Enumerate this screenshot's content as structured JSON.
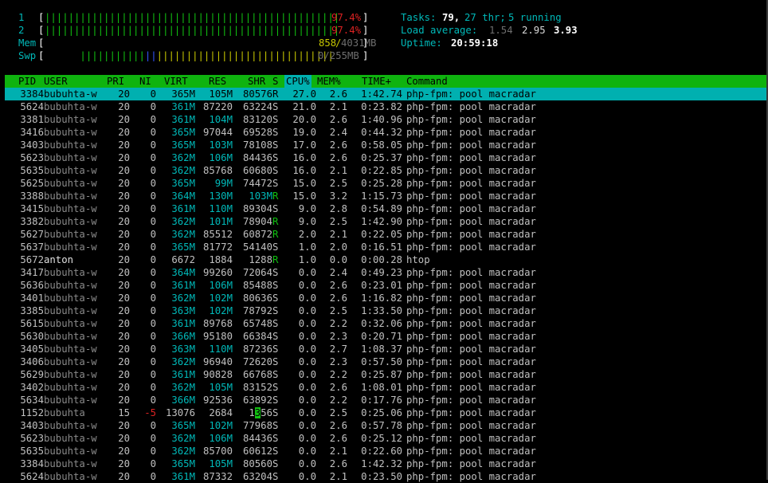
{
  "meters": {
    "cpu1": {
      "label": "1",
      "percent": "97.4%"
    },
    "cpu2": {
      "label": "2",
      "percent": "97.4%"
    },
    "mem": {
      "label": "Mem",
      "used": "858",
      "total": "4031MB"
    },
    "swp": {
      "label": "Swp",
      "value": "0/255MB"
    }
  },
  "meter_fill": {
    "cpu1": 0.974,
    "cpu2": 0.974,
    "mem": 0.213,
    "swp": 0.0
  },
  "stats": {
    "tasks_label": "Tasks:",
    "tasks": "79,",
    "threads": "27 thr;",
    "running": "5 running",
    "load_label": "Load average:",
    "load1": "1.54",
    "load5": "2.95",
    "load15": "3.93",
    "uptime_label": "Uptime:",
    "uptime": "20:59:18"
  },
  "columns": [
    "PID",
    "USER",
    "PRI",
    "NI",
    "VIRT",
    "RES",
    "SHR",
    "S",
    "CPU%",
    "MEM%",
    "TIME+",
    "Command"
  ],
  "sorted_column": "CPU%",
  "processes": [
    {
      "pid": "3384",
      "user": "bubuhta-w",
      "pri": "20",
      "ni": "0",
      "virt": "365M",
      "res": "105M",
      "shr": "80576",
      "s": "R",
      "cpu": "27.0",
      "mem": "2.6",
      "time": "1:42.74",
      "cmd": "php-fpm: pool macradar",
      "selected": true
    },
    {
      "pid": "5624",
      "user": "bubuhta-w",
      "pri": "20",
      "ni": "0",
      "virt": "361M",
      "res": "87220",
      "shr": "63224",
      "s": "S",
      "cpu": "21.0",
      "mem": "2.1",
      "time": "0:23.82",
      "cmd": "php-fpm: pool macradar"
    },
    {
      "pid": "3381",
      "user": "bubuhta-w",
      "pri": "20",
      "ni": "0",
      "virt": "361M",
      "res": "104M",
      "shr": "83120",
      "s": "S",
      "cpu": "20.0",
      "mem": "2.6",
      "time": "1:40.96",
      "cmd": "php-fpm: pool macradar"
    },
    {
      "pid": "3416",
      "user": "bubuhta-w",
      "pri": "20",
      "ni": "0",
      "virt": "365M",
      "res": "97044",
      "shr": "69528",
      "s": "S",
      "cpu": "19.0",
      "mem": "2.4",
      "time": "0:44.32",
      "cmd": "php-fpm: pool macradar"
    },
    {
      "pid": "3403",
      "user": "bubuhta-w",
      "pri": "20",
      "ni": "0",
      "virt": "365M",
      "res": "103M",
      "shr": "78108",
      "s": "S",
      "cpu": "17.0",
      "mem": "2.6",
      "time": "0:58.05",
      "cmd": "php-fpm: pool macradar"
    },
    {
      "pid": "5623",
      "user": "bubuhta-w",
      "pri": "20",
      "ni": "0",
      "virt": "362M",
      "res": "106M",
      "shr": "84436",
      "s": "S",
      "cpu": "16.0",
      "mem": "2.6",
      "time": "0:25.37",
      "cmd": "php-fpm: pool macradar"
    },
    {
      "pid": "5635",
      "user": "bubuhta-w",
      "pri": "20",
      "ni": "0",
      "virt": "362M",
      "res": "85768",
      "shr": "60680",
      "s": "S",
      "cpu": "16.0",
      "mem": "2.1",
      "time": "0:22.85",
      "cmd": "php-fpm: pool macradar"
    },
    {
      "pid": "5625",
      "user": "bubuhta-w",
      "pri": "20",
      "ni": "0",
      "virt": "365M",
      "res": "99M",
      "shr": "74472",
      "s": "S",
      "cpu": "15.0",
      "mem": "2.5",
      "time": "0:25.28",
      "cmd": "php-fpm: pool macradar"
    },
    {
      "pid": "3388",
      "user": "bubuhta-w",
      "pri": "20",
      "ni": "0",
      "virt": "364M",
      "res": "130M",
      "shr": "103M",
      "s": "R",
      "cpu": "15.0",
      "mem": "3.2",
      "time": "1:15.73",
      "cmd": "php-fpm: pool macradar"
    },
    {
      "pid": "3415",
      "user": "bubuhta-w",
      "pri": "20",
      "ni": "0",
      "virt": "361M",
      "res": "110M",
      "shr": "89304",
      "s": "S",
      "cpu": "9.0",
      "mem": "2.8",
      "time": "0:54.89",
      "cmd": "php-fpm: pool macradar"
    },
    {
      "pid": "3382",
      "user": "bubuhta-w",
      "pri": "20",
      "ni": "0",
      "virt": "362M",
      "res": "101M",
      "shr": "78904",
      "s": "R",
      "cpu": "9.0",
      "mem": "2.5",
      "time": "1:42.90",
      "cmd": "php-fpm: pool macradar"
    },
    {
      "pid": "5627",
      "user": "bubuhta-w",
      "pri": "20",
      "ni": "0",
      "virt": "362M",
      "res": "85512",
      "shr": "60872",
      "s": "R",
      "cpu": "2.0",
      "mem": "2.1",
      "time": "0:22.05",
      "cmd": "php-fpm: pool macradar"
    },
    {
      "pid": "5637",
      "user": "bubuhta-w",
      "pri": "20",
      "ni": "0",
      "virt": "365M",
      "res": "81772",
      "shr": "54140",
      "s": "S",
      "cpu": "1.0",
      "mem": "2.0",
      "time": "0:16.51",
      "cmd": "php-fpm: pool macradar"
    },
    {
      "pid": "5672",
      "user": "anton",
      "pri": "20",
      "ni": "0",
      "virt": "6672",
      "res": "1884",
      "shr": "1288",
      "s": "R",
      "cpu": "1.0",
      "mem": "0.0",
      "time": "0:00.28",
      "cmd": "htop",
      "bright_user": true
    },
    {
      "pid": "3417",
      "user": "bubuhta-w",
      "pri": "20",
      "ni": "0",
      "virt": "364M",
      "res": "99260",
      "shr": "72064",
      "s": "S",
      "cpu": "0.0",
      "mem": "2.4",
      "time": "0:49.23",
      "cmd": "php-fpm: pool macradar"
    },
    {
      "pid": "5636",
      "user": "bubuhta-w",
      "pri": "20",
      "ni": "0",
      "virt": "361M",
      "res": "106M",
      "shr": "85488",
      "s": "S",
      "cpu": "0.0",
      "mem": "2.6",
      "time": "0:23.01",
      "cmd": "php-fpm: pool macradar"
    },
    {
      "pid": "3401",
      "user": "bubuhta-w",
      "pri": "20",
      "ni": "0",
      "virt": "362M",
      "res": "102M",
      "shr": "80636",
      "s": "S",
      "cpu": "0.0",
      "mem": "2.6",
      "time": "1:16.82",
      "cmd": "php-fpm: pool macradar"
    },
    {
      "pid": "3385",
      "user": "bubuhta-w",
      "pri": "20",
      "ni": "0",
      "virt": "363M",
      "res": "102M",
      "shr": "78792",
      "s": "S",
      "cpu": "0.0",
      "mem": "2.5",
      "time": "1:33.50",
      "cmd": "php-fpm: pool macradar"
    },
    {
      "pid": "5615",
      "user": "bubuhta-w",
      "pri": "20",
      "ni": "0",
      "virt": "361M",
      "res": "89768",
      "shr": "65748",
      "s": "S",
      "cpu": "0.0",
      "mem": "2.2",
      "time": "0:32.06",
      "cmd": "php-fpm: pool macradar"
    },
    {
      "pid": "5630",
      "user": "bubuhta-w",
      "pri": "20",
      "ni": "0",
      "virt": "366M",
      "res": "95180",
      "shr": "66384",
      "s": "S",
      "cpu": "0.0",
      "mem": "2.3",
      "time": "0:20.71",
      "cmd": "php-fpm: pool macradar"
    },
    {
      "pid": "3405",
      "user": "bubuhta-w",
      "pri": "20",
      "ni": "0",
      "virt": "363M",
      "res": "110M",
      "shr": "87236",
      "s": "S",
      "cpu": "0.0",
      "mem": "2.7",
      "time": "1:08.37",
      "cmd": "php-fpm: pool macradar"
    },
    {
      "pid": "3406",
      "user": "bubuhta-w",
      "pri": "20",
      "ni": "0",
      "virt": "362M",
      "res": "96940",
      "shr": "72620",
      "s": "S",
      "cpu": "0.0",
      "mem": "2.3",
      "time": "0:57.50",
      "cmd": "php-fpm: pool macradar"
    },
    {
      "pid": "5629",
      "user": "bubuhta-w",
      "pri": "20",
      "ni": "0",
      "virt": "361M",
      "res": "90828",
      "shr": "66768",
      "s": "S",
      "cpu": "0.0",
      "mem": "2.2",
      "time": "0:25.87",
      "cmd": "php-fpm: pool macradar"
    },
    {
      "pid": "3402",
      "user": "bubuhta-w",
      "pri": "20",
      "ni": "0",
      "virt": "362M",
      "res": "105M",
      "shr": "83152",
      "s": "S",
      "cpu": "0.0",
      "mem": "2.6",
      "time": "1:08.01",
      "cmd": "php-fpm: pool macradar"
    },
    {
      "pid": "5634",
      "user": "bubuhta-w",
      "pri": "20",
      "ni": "0",
      "virt": "366M",
      "res": "92536",
      "shr": "63892",
      "s": "S",
      "cpu": "0.0",
      "mem": "2.2",
      "time": "0:17.76",
      "cmd": "php-fpm: pool macradar"
    },
    {
      "pid": "1152",
      "user": "bubuhta",
      "pri": "15",
      "ni": "-5",
      "virt": "13076",
      "res": "2684",
      "shr": "1356",
      "s": "S",
      "cpu": "0.0",
      "mem": "2.5",
      "time": "0:25.06",
      "cmd": "php-fpm: pool macradar",
      "neg_ni": true,
      "cursor": true
    },
    {
      "pid": "3403",
      "user": "bubuhta-w",
      "pri": "20",
      "ni": "0",
      "virt": "365M",
      "res": "102M",
      "shr": "77968",
      "s": "S",
      "cpu": "0.0",
      "mem": "2.6",
      "time": "0:57.78",
      "cmd": "php-fpm: pool macradar"
    },
    {
      "pid": "5623",
      "user": "bubuhta-w",
      "pri": "20",
      "ni": "0",
      "virt": "362M",
      "res": "106M",
      "shr": "84436",
      "s": "S",
      "cpu": "0.0",
      "mem": "2.6",
      "time": "0:25.12",
      "cmd": "php-fpm: pool macradar"
    },
    {
      "pid": "5635",
      "user": "bubuhta-w",
      "pri": "20",
      "ni": "0",
      "virt": "362M",
      "res": "85700",
      "shr": "60612",
      "s": "S",
      "cpu": "0.0",
      "mem": "2.1",
      "time": "0:22.60",
      "cmd": "php-fpm: pool macradar"
    },
    {
      "pid": "3384",
      "user": "bubuhta-w",
      "pri": "20",
      "ni": "0",
      "virt": "365M",
      "res": "105M",
      "shr": "80560",
      "s": "S",
      "cpu": "0.0",
      "mem": "2.6",
      "time": "1:42.32",
      "cmd": "php-fpm: pool macradar"
    },
    {
      "pid": "5624",
      "user": "bubuhta-w",
      "pri": "20",
      "ni": "0",
      "virt": "361M",
      "res": "87332",
      "shr": "63204",
      "s": "S",
      "cpu": "0.0",
      "mem": "2.1",
      "time": "0:23.50",
      "cmd": "php-fpm: pool macradar"
    }
  ],
  "colors": {
    "header_bg": "#0fb30f",
    "selected_bg": "#00b0b0",
    "accent_cyan": "#00b8b8",
    "accent_green": "#11c211",
    "accent_red": "#dd2222"
  }
}
